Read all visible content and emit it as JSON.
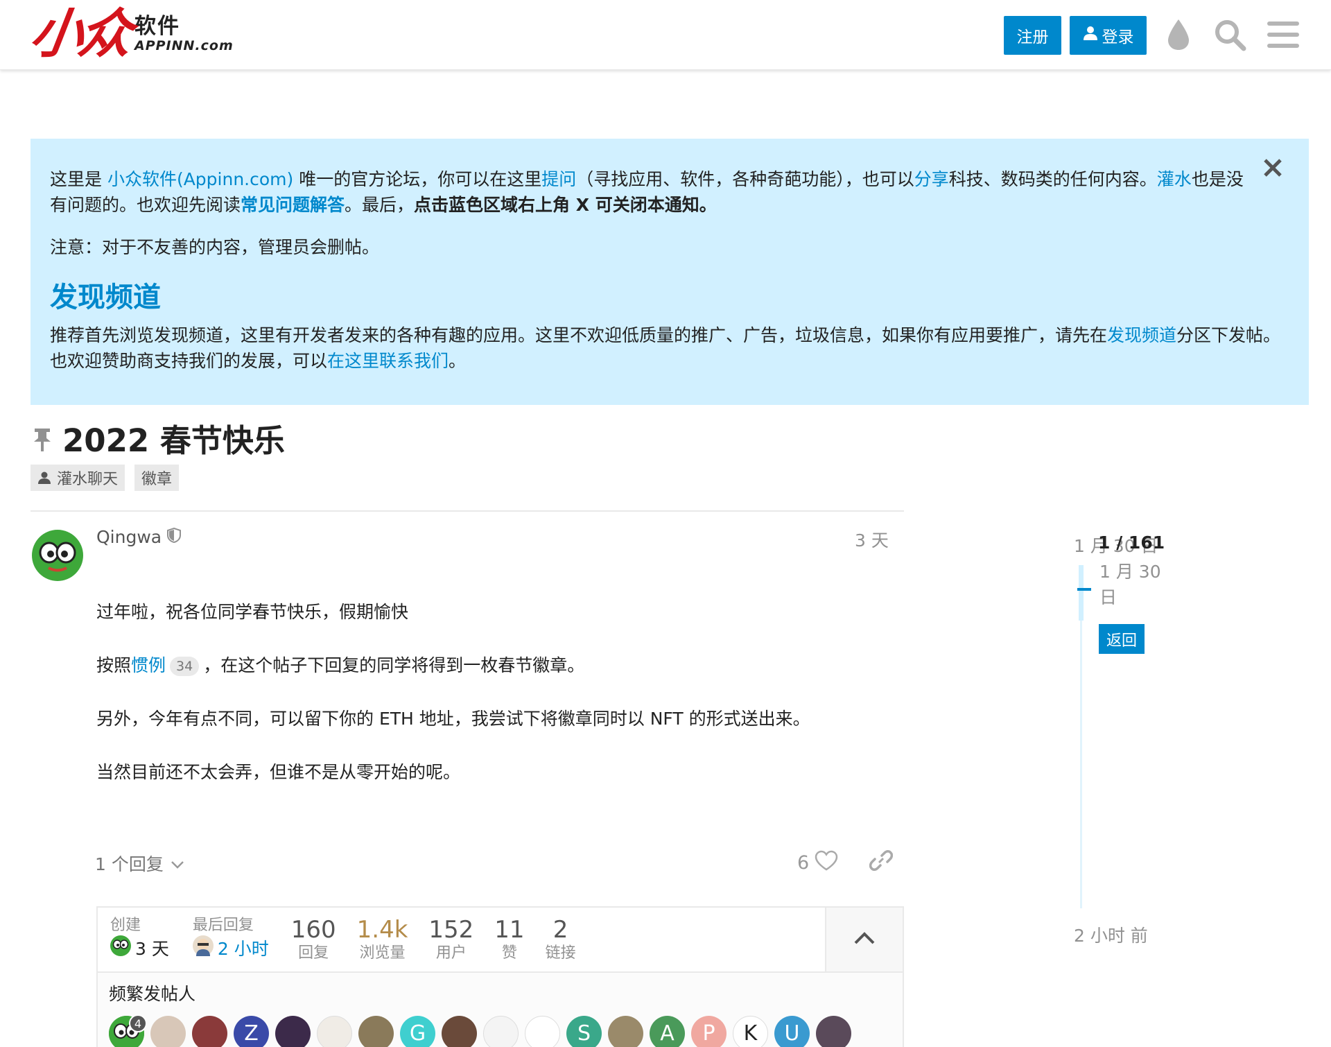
{
  "header": {
    "logo_mark": "小众",
    "logo_cn": "软件",
    "logo_en": "APPINN.com",
    "signup_label": "注册",
    "login_label": "登录",
    "icons": [
      "user-icon",
      "theme-drop-icon",
      "search-icon",
      "menu-icon"
    ]
  },
  "banner": {
    "p1_a": "这里是 ",
    "p1_link1": "小众软件(Appinn.com)",
    "p1_b": " 唯一的官方论坛，你可以在这里",
    "p1_link2": "提问",
    "p1_c": "（寻找应用、软件，各种奇葩功能），也可以",
    "p1_link3": "分享",
    "p1_d": "科技、数码类的任何内容。",
    "p1_link4": "灌水",
    "p1_e": "也是没有问题的。也欢迎先阅读",
    "p1_link5": "常见问题解答",
    "p1_f": "。最后，",
    "p1_bold": "点击蓝色区域右上角 X 可关闭本通知。",
    "p2": "注意：对于不友善的内容，管理员会删帖。",
    "heading": "发现频道",
    "p3_a": "推荐首先浏览发现频道，这里有开发者发来的各种有趣的应用。这里不欢迎低质量的推广、广告，垃圾信息，如果你有应用要推广，请先在",
    "p3_link1": "发现频道",
    "p3_b": "分区下发帖。也欢迎赞助商支持我们的发展，可以",
    "p3_link2": "在这里联系我们",
    "p3_c": "。"
  },
  "topic": {
    "title": "2022 春节快乐",
    "category": "灌水聊天",
    "tag": "徽章"
  },
  "post": {
    "username": "Qingwa",
    "date": "3 天",
    "line1": "过年啦，祝各位同学春节快乐，假期愉快",
    "line2_a": "按照",
    "line2_link": "惯例",
    "line2_count": "34",
    "line2_b": "，在这个帖子下回复的同学将得到一枚春节徽章。",
    "line3": "另外，今年有点不同，可以留下你的 ETH 地址，我尝试下将徽章同时以 NFT 的形式送出来。",
    "line4": "当然目前还不太会弄，但谁不是从零开始的呢。",
    "replies_toggle": "1 个回复",
    "likes": "6"
  },
  "topic_map": {
    "created_label": "创建",
    "created_value": "3 天",
    "last_reply_label": "最后回复",
    "last_reply_value": "2 小时",
    "stats": [
      {
        "value": "160",
        "label": "回复"
      },
      {
        "value": "1.4k",
        "label": "浏览量"
      },
      {
        "value": "152",
        "label": "用户"
      },
      {
        "value": "11",
        "label": "赞"
      },
      {
        "value": "2",
        "label": "链接"
      }
    ],
    "frequent_posters_label": "频繁发帖人",
    "first_poster_count": "4",
    "posters": [
      {
        "letter": "",
        "color": "#4caf50"
      },
      {
        "letter": "",
        "color": "#d8c7b8"
      },
      {
        "letter": "",
        "color": "#8a3a3a"
      },
      {
        "letter": "Z",
        "color": "#3a4aa8"
      },
      {
        "letter": "",
        "color": "#3c2a4a"
      },
      {
        "letter": "",
        "color": "#f0ece6"
      },
      {
        "letter": "",
        "color": "#8a7a5a"
      },
      {
        "letter": "G",
        "color": "#3fcfcf"
      },
      {
        "letter": "",
        "color": "#6a4a3a"
      },
      {
        "letter": "",
        "color": "#f4f4f4"
      },
      {
        "letter": "",
        "color": "#ffffff"
      },
      {
        "letter": "S",
        "color": "#3aa88a"
      },
      {
        "letter": "",
        "color": "#9a8a6a"
      },
      {
        "letter": "A",
        "color": "#4a9a5a"
      },
      {
        "letter": "P",
        "color": "#f0a8a0"
      },
      {
        "letter": "K",
        "color": "#ffffff"
      },
      {
        "letter": "U",
        "color": "#3a9ad0"
      },
      {
        "letter": "",
        "color": "#5a4a5a"
      }
    ]
  },
  "timeline": {
    "start": "1 月 30 日",
    "progress": "1 / 161",
    "current_date": "1 月 30 日",
    "back_label": "返回",
    "end": "2 小时 前"
  },
  "colors": {
    "accent": "#0088cc",
    "banner_bg": "#d1f0ff",
    "logo_red": "#d4141c",
    "views_hot": "#b48c4a"
  }
}
